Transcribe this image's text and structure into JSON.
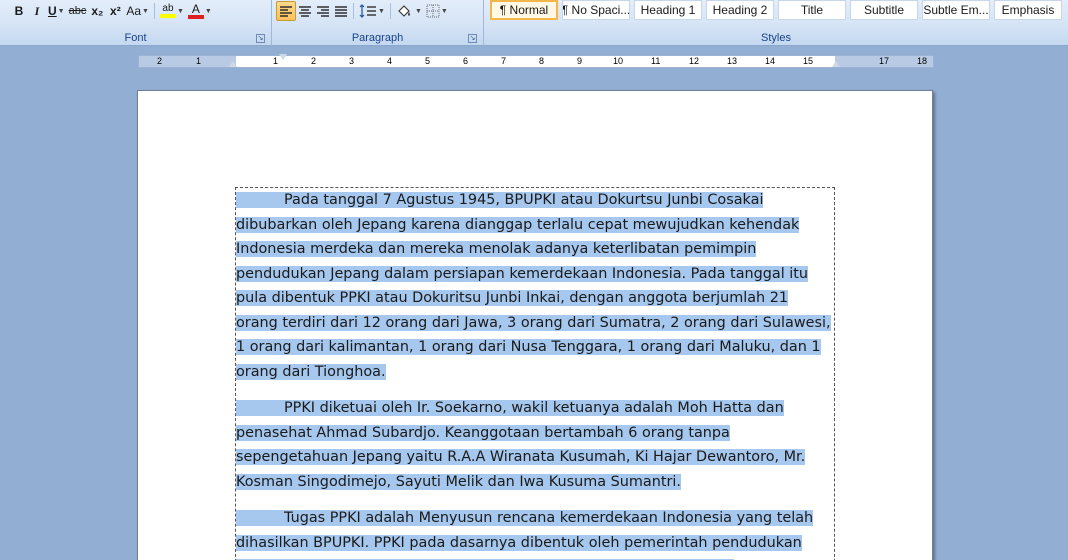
{
  "ribbon": {
    "font_group": {
      "label": "Font",
      "bold": "B",
      "italic": "I",
      "underline": "U",
      "strikethrough": "abc",
      "subscript": "x₂",
      "superscript": "x²",
      "change_case": "Aa",
      "highlight_glyph": "ab",
      "font_color_glyph": "A"
    },
    "paragraph_group": {
      "label": "Paragraph"
    },
    "styles_group": {
      "label": "Styles",
      "items": [
        {
          "label": "¶ Normal",
          "selected": true
        },
        {
          "label": "¶ No Spaci...",
          "selected": false
        },
        {
          "label": "Heading 1",
          "selected": false
        },
        {
          "label": "Heading 2",
          "selected": false
        },
        {
          "label": "Title",
          "selected": false
        },
        {
          "label": "Subtitle",
          "selected": false
        },
        {
          "label": "Subtle Em...",
          "selected": false
        },
        {
          "label": "Emphasis",
          "selected": false
        }
      ]
    },
    "colors": {
      "highlight": "#ffff00",
      "font_color": "#e02020"
    }
  },
  "ruler": {
    "numbers": [
      "2",
      "1",
      "1",
      "2",
      "3",
      "4",
      "5",
      "6",
      "7",
      "8",
      "9",
      "10",
      "11",
      "12",
      "13",
      "14",
      "15",
      "17",
      "18"
    ]
  },
  "document": {
    "paragraphs": [
      "Pada tanggal 7 Agustus 1945, BPUPKI atau Dokurtsu Junbi Cosakai dibubarkan oleh Jepang karena dianggap terlalu cepat mewujudkan kehendak Indonesia merdeka dan mereka menolak adanya keterlibatan pemimpin pendudukan Jepang dalam persiapan kemerdekaan Indonesia. Pada tanggal itu pula dibentuk PPKI atau Dokuritsu Junbi Inkai, dengan anggota berjumlah 21 orang terdiri dari 12 orang dari Jawa, 3 orang dari Sumatra, 2 orang dari Sulawesi, 1 orang dari kalimantan, 1 orang dari Nusa Tenggara, 1 orang dari Maluku, dan 1 orang dari Tionghoa.",
      "PPKI diketuai oleh Ir. Soekarno, wakil ketuanya adalah Moh Hatta dan penasehat Ahmad Subardjo. Keanggotaan bertambah 6 orang tanpa sepengetahuan Jepang yaitu R.A.A Wiranata Kusumah, Ki Hajar Dewantoro, Mr. Kosman Singodimejo, Sayuti Melik dan Iwa Kusuma Sumantri.",
      "Tugas PPKI adalah Menyusun rencana kemerdekaan Indonesia yang telah dihasilkan BPUPKI. PPKI pada dasarnya dibentuk oleh pemerintah pendudukan Jepang sebagai upaya yang menarik simpati dari berbagai golongan."
    ],
    "selection_color": "#a6c8ee"
  }
}
